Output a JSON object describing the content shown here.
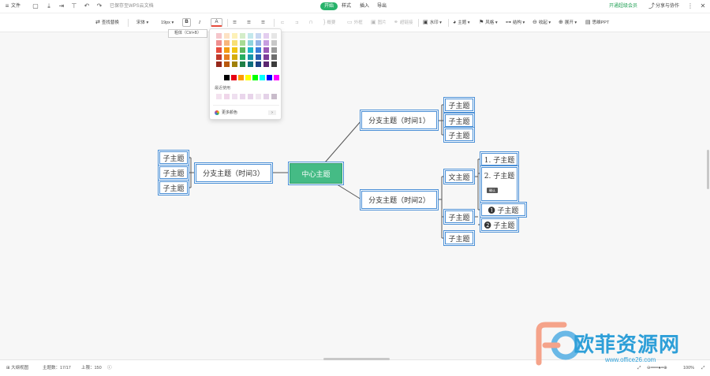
{
  "topbar": {
    "file_menu": "文件",
    "save_note": "已保存至WPS云文档",
    "tabs": [
      "开始",
      "样式",
      "插入",
      "导出"
    ],
    "active_tab": "开始",
    "member_link": "开通超级会员",
    "share_label": "分享与协作"
  },
  "toolbar": {
    "find_replace": "查找替换",
    "font": "宋体",
    "font_size": "19px",
    "bold": "B",
    "italic": "I",
    "font_color": "A",
    "items_right": [
      "概要",
      "外框",
      "图片",
      "超链接",
      "水印",
      "主题",
      "风格",
      "结构",
      "收起",
      "展开",
      "思维PPT"
    ],
    "disabled_items": [
      "概要",
      "外框",
      "图片",
      "超链接"
    ]
  },
  "color_popup": {
    "tooltip": "粗体（Ctrl+B）",
    "recent_label": "最近使用",
    "more_colors": "更多颜色",
    "palette_rows": [
      [
        "#f5c6cb",
        "#fde2c4",
        "#fdf1b8",
        "#d4edc9",
        "#c3e8ec",
        "#c9d8f2",
        "#e3cdef",
        "#e6e6e6"
      ],
      [
        "#ef8f8f",
        "#f8b67c",
        "#f7df75",
        "#a7db93",
        "#8ed3dd",
        "#93b3e6",
        "#c79ee0",
        "#c8c8c8"
      ],
      [
        "#e84c3d",
        "#f39c12",
        "#f1c40f",
        "#5cb85c",
        "#1fb5c8",
        "#3b7dd8",
        "#9b59b6",
        "#9a9a9a"
      ],
      [
        "#c0392b",
        "#e67e22",
        "#d4ac0d",
        "#27ae60",
        "#1795a8",
        "#2a5db0",
        "#7d3c98",
        "#6e6e6e"
      ],
      [
        "#96281b",
        "#b9590e",
        "#a0800a",
        "#1e7f46",
        "#0e6f7e",
        "#1d4185",
        "#5b2670",
        "#3c3c3c"
      ]
    ],
    "standard_row": [
      "#000000",
      "#e60012",
      "#ff9900",
      "#ffff00",
      "#00ff00",
      "#00ffff",
      "#0000ff",
      "#ff00ff"
    ],
    "recent_row": [
      "#f3e2ef",
      "#f0d6ea",
      "#efe0f0",
      "#ead6ec",
      "#e8d4ea",
      "#f0e6f0",
      "#e4d2e8",
      "#c9bccb"
    ]
  },
  "mindmap": {
    "center": "中心主题",
    "branch_1": "分支主题（时间1）",
    "branch_2": "分支主题（时间2）",
    "branch_3": "分支主题（时间3）",
    "sub_topic": "子主题",
    "sub_topic_alt": "文主题",
    "numbered_1": "1. 子主题",
    "numbered_2": "2. 子主题",
    "badge_1": "❶ 子主题",
    "badge_2": "❷ 子主题",
    "cursor_label": "确认"
  },
  "statusbar": {
    "outline_view": "大纲视图",
    "topic_count": "主题数：17/17",
    "limit": "上限：150",
    "zoom": "100%"
  },
  "watermark": {
    "brand": "欧菲资源网",
    "url": "www.office26.com"
  },
  "colors": {
    "accent": "#27b36b",
    "center_node": "#45bb85",
    "node_border": "#4a8fd6",
    "member_link": "#27a35a"
  }
}
